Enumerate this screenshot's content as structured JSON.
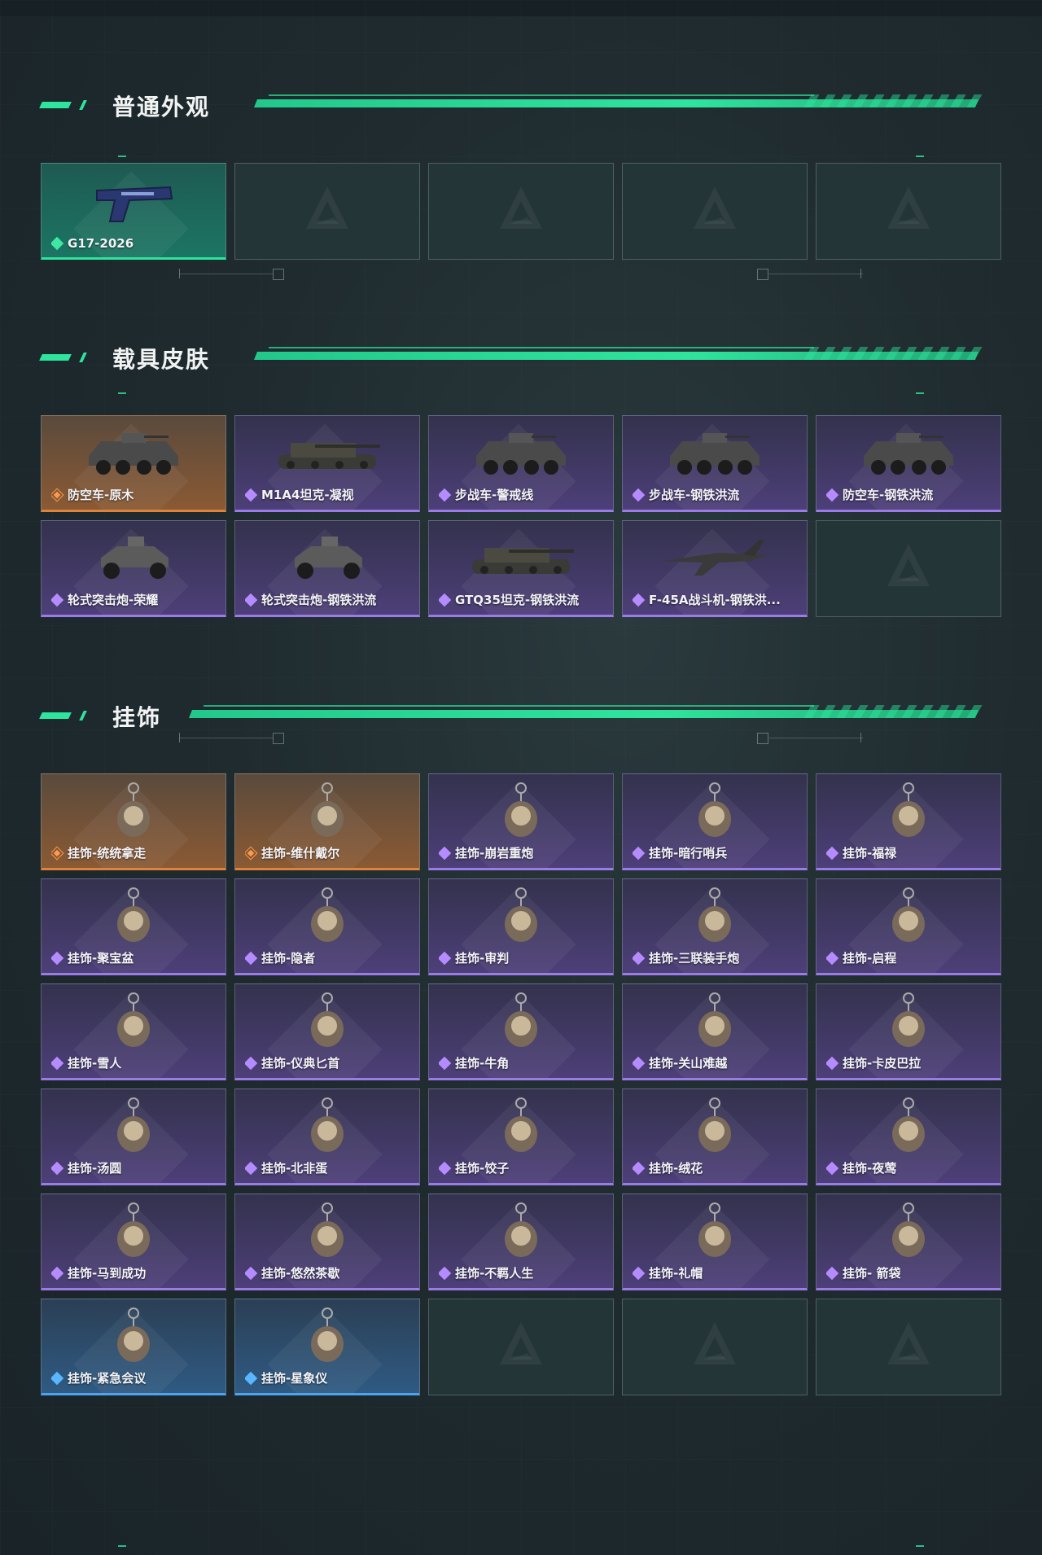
{
  "colors": {
    "accent": "#2ee59d",
    "rarity_purple": "#9b7be8",
    "rarity_orange": "#e0823a",
    "rarity_green": "#2ee59d",
    "rarity_blue": "#4ea3f0"
  },
  "sections": {
    "normal": {
      "title": "普通外观",
      "items": [
        {
          "label": "G17-2026",
          "rarity": "green",
          "icon": "pistol-icon"
        },
        {
          "label": "",
          "rarity": "empty"
        },
        {
          "label": "",
          "rarity": "empty"
        },
        {
          "label": "",
          "rarity": "empty"
        },
        {
          "label": "",
          "rarity": "empty"
        }
      ]
    },
    "vehicles": {
      "title": "载具皮肤",
      "items": [
        {
          "label": "防空车-原木",
          "rarity": "orange",
          "icon": "apc-icon"
        },
        {
          "label": "M1A4坦克-凝视",
          "rarity": "purple",
          "icon": "tank-icon"
        },
        {
          "label": "步战车-警戒线",
          "rarity": "purple",
          "icon": "apc-icon"
        },
        {
          "label": "步战车-钢铁洪流",
          "rarity": "purple",
          "icon": "apc-icon"
        },
        {
          "label": "防空车-钢铁洪流",
          "rarity": "purple",
          "icon": "apc-icon"
        },
        {
          "label": "轮式突击炮-荣耀",
          "rarity": "purple",
          "icon": "buggy-icon"
        },
        {
          "label": "轮式突击炮-钢铁洪流",
          "rarity": "purple",
          "icon": "buggy-icon"
        },
        {
          "label": "GTQ35坦克-钢铁洪流",
          "rarity": "purple",
          "icon": "tank-icon"
        },
        {
          "label": "F-45A战斗机-钢铁洪...",
          "rarity": "purple",
          "icon": "jet-icon"
        },
        {
          "label": "",
          "rarity": "empty"
        }
      ]
    },
    "charms": {
      "title": "挂饰",
      "items": [
        {
          "label": "挂饰-统统拿走",
          "rarity": "orange",
          "icon": "charm-icon"
        },
        {
          "label": "挂饰-维什戴尔",
          "rarity": "orange",
          "icon": "charm-icon"
        },
        {
          "label": "挂饰-崩岩重炮",
          "rarity": "purple",
          "icon": "charm-icon"
        },
        {
          "label": "挂饰-暗行哨兵",
          "rarity": "purple",
          "icon": "charm-icon"
        },
        {
          "label": "挂饰-福禄",
          "rarity": "purple",
          "icon": "charm-icon"
        },
        {
          "label": "挂饰-聚宝盆",
          "rarity": "purple",
          "icon": "charm-icon"
        },
        {
          "label": "挂饰-隐者",
          "rarity": "purple",
          "icon": "charm-icon"
        },
        {
          "label": "挂饰-审判",
          "rarity": "purple",
          "icon": "charm-icon"
        },
        {
          "label": "挂饰-三联装手炮",
          "rarity": "purple",
          "icon": "charm-icon"
        },
        {
          "label": "挂饰-启程",
          "rarity": "purple",
          "icon": "charm-icon"
        },
        {
          "label": "挂饰-雪人",
          "rarity": "purple",
          "icon": "charm-icon"
        },
        {
          "label": "挂饰-仪典匕首",
          "rarity": "purple",
          "icon": "charm-icon"
        },
        {
          "label": "挂饰-牛角",
          "rarity": "purple",
          "icon": "charm-icon"
        },
        {
          "label": "挂饰-关山难越",
          "rarity": "purple",
          "icon": "charm-icon"
        },
        {
          "label": "挂饰-卡皮巴拉",
          "rarity": "purple",
          "icon": "charm-icon"
        },
        {
          "label": "挂饰-汤圆",
          "rarity": "purple",
          "icon": "charm-icon"
        },
        {
          "label": "挂饰-北非蛋",
          "rarity": "purple",
          "icon": "charm-icon"
        },
        {
          "label": "挂饰-饺子",
          "rarity": "purple",
          "icon": "charm-icon"
        },
        {
          "label": "挂饰-绒花",
          "rarity": "purple",
          "icon": "charm-icon"
        },
        {
          "label": "挂饰-夜莺",
          "rarity": "purple",
          "icon": "charm-icon"
        },
        {
          "label": "挂饰-马到成功",
          "rarity": "purple",
          "icon": "charm-icon"
        },
        {
          "label": "挂饰-悠然茶歇",
          "rarity": "purple",
          "icon": "charm-icon"
        },
        {
          "label": "挂饰-不羁人生",
          "rarity": "purple",
          "icon": "charm-icon"
        },
        {
          "label": "挂饰-礼帽",
          "rarity": "purple",
          "icon": "charm-icon"
        },
        {
          "label": "挂饰- 箭袋",
          "rarity": "purple",
          "icon": "charm-icon"
        },
        {
          "label": "挂饰-紧急会议",
          "rarity": "blue",
          "icon": "charm-icon"
        },
        {
          "label": "挂饰-星象仪",
          "rarity": "blue",
          "icon": "charm-icon"
        },
        {
          "label": "",
          "rarity": "empty"
        },
        {
          "label": "",
          "rarity": "empty"
        },
        {
          "label": "",
          "rarity": "empty"
        }
      ]
    }
  }
}
